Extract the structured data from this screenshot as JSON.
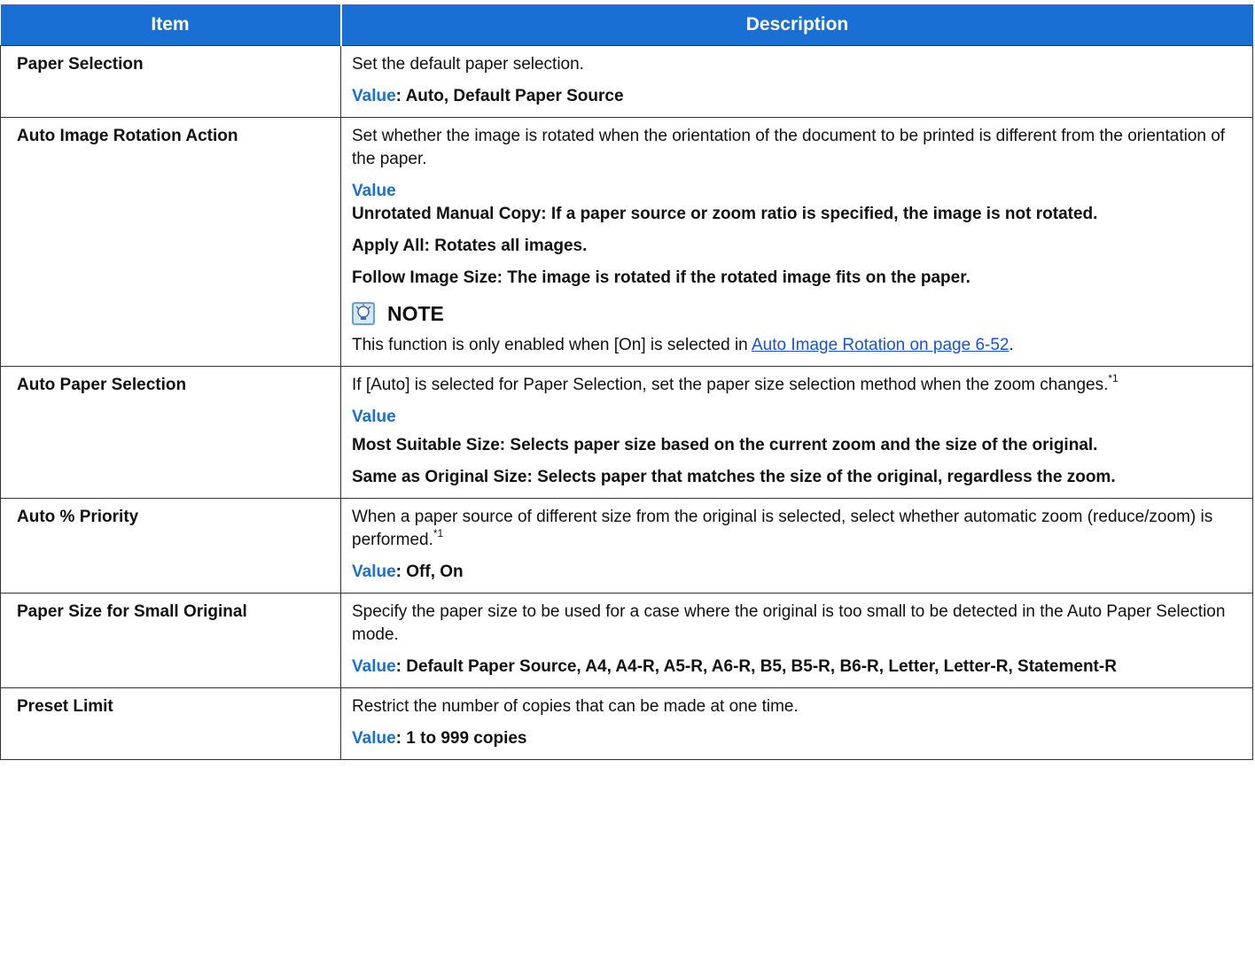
{
  "headers": {
    "item": "Item",
    "description": "Description"
  },
  "rows": [
    {
      "item": "Paper Selection",
      "desc": "Set the default paper selection.",
      "value_label": "Value",
      "value_colon": ": ",
      "value": "Auto, Default Paper Source"
    },
    {
      "item": "Auto Image Rotation Action",
      "desc": "Set whether the image is rotated when the orientation of the document to be printed is different from the orientation of the paper.",
      "value_label": "Value",
      "options": [
        "Unrotated Manual Copy: If a paper source or zoom ratio is specified, the image is not rotated.",
        "Apply All: Rotates all images.",
        "Follow Image Size: The image is rotated if the rotated image fits on the paper."
      ],
      "note_title": "NOTE",
      "note_text_before": "This function is only enabled when [On] is selected in ",
      "note_link": "Auto Image Rotation on page 6-52",
      "note_text_after": "."
    },
    {
      "item": "Auto Paper Selection",
      "desc": "If [Auto] is selected for Paper Selection, set the paper size selection method when the zoom changes.",
      "footnote": "*1",
      "value_label": "Value",
      "options": [
        "Most Suitable Size: Selects paper size based on the current zoom and the size of the original.",
        "Same as Original Size: Selects paper that matches the size of the original, regardless the zoom."
      ]
    },
    {
      "item": "Auto % Priority",
      "desc": "When a paper source of different size from the original is selected, select whether automatic zoom (reduce/zoom) is performed.",
      "footnote": "*1",
      "value_label": "Value",
      "value_colon": ": ",
      "value": "Off, On"
    },
    {
      "item": "Paper Size for Small Original",
      "desc": "Specify the paper size to be used for a case where the original is too small to be detected in the Auto Paper Selection mode.",
      "value_label": "Value",
      "value_colon": ": ",
      "value": "Default Paper Source, A4, A4-R, A5-R, A6-R, B5, B5-R, B6-R, Letter, Letter-R, Statement-R"
    },
    {
      "item": "Preset Limit",
      "desc": "Restrict the number of copies that can be made at one time.",
      "value_label": "Value",
      "value_colon": ": ",
      "value": "1 to 999 copies"
    }
  ],
  "colors": {
    "header_bg": "#1a6fd4",
    "value_blue": "#1a6fd4",
    "link": "#1a4fe0"
  },
  "icons": {
    "note": "note-bulb-icon"
  }
}
